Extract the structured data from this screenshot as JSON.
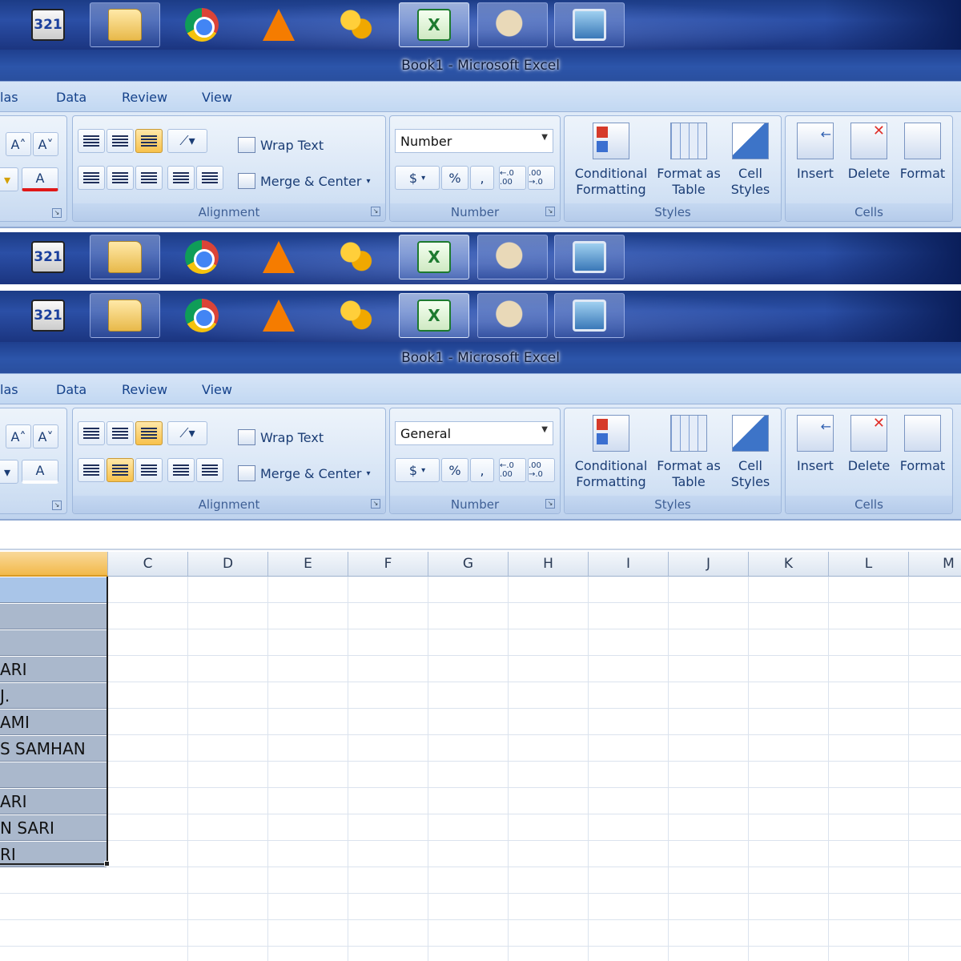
{
  "taskbar": {
    "items": [
      {
        "icon": "media-player-classic-icon",
        "label": "321"
      },
      {
        "icon": "file-explorer-icon",
        "label": ""
      },
      {
        "icon": "chrome-icon",
        "label": ""
      },
      {
        "icon": "vlc-cone-icon",
        "label": ""
      },
      {
        "icon": "keys-app-icon",
        "label": ""
      },
      {
        "icon": "excel-icon",
        "label": "X"
      },
      {
        "icon": "paint-palette-icon",
        "label": ""
      },
      {
        "icon": "picture-viewer-icon",
        "label": ""
      }
    ]
  },
  "window": {
    "title": "Book1  -  Microsoft Excel"
  },
  "ribbon_tabs": [
    "las",
    "Data",
    "Review",
    "View"
  ],
  "ribbon1": {
    "font_buttons": {
      "grow": "A˄",
      "shrink": "A˅",
      "font_color": "A"
    },
    "alignment": {
      "wrap_text": "Wrap Text",
      "merge_center": "Merge & Center",
      "caption": "Alignment"
    },
    "number": {
      "format_value": "Number",
      "currency": "$",
      "percent": "%",
      "comma": ",",
      "inc_decimal": "←.0 .00",
      "dec_decimal": ".00 →.0",
      "caption": "Number"
    },
    "styles": {
      "conditional": "Conditional Formatting",
      "format_table": "Format as Table",
      "cell_styles": "Cell Styles",
      "caption": "Styles"
    },
    "cells": {
      "insert": "Insert",
      "delete": "Delete",
      "format": "Format",
      "caption": "Cells"
    }
  },
  "ribbon2": {
    "number": {
      "format_value": "General"
    }
  },
  "columns": [
    "C",
    "D",
    "E",
    "F",
    "G",
    "H",
    "I",
    "J",
    "K",
    "L",
    "M"
  ],
  "column_b_cells": [
    "",
    "",
    "",
    "ARI",
    "J.",
    "AMI",
    "S SAMHAN",
    "",
    "ARI",
    "N SARI",
    "RI"
  ]
}
